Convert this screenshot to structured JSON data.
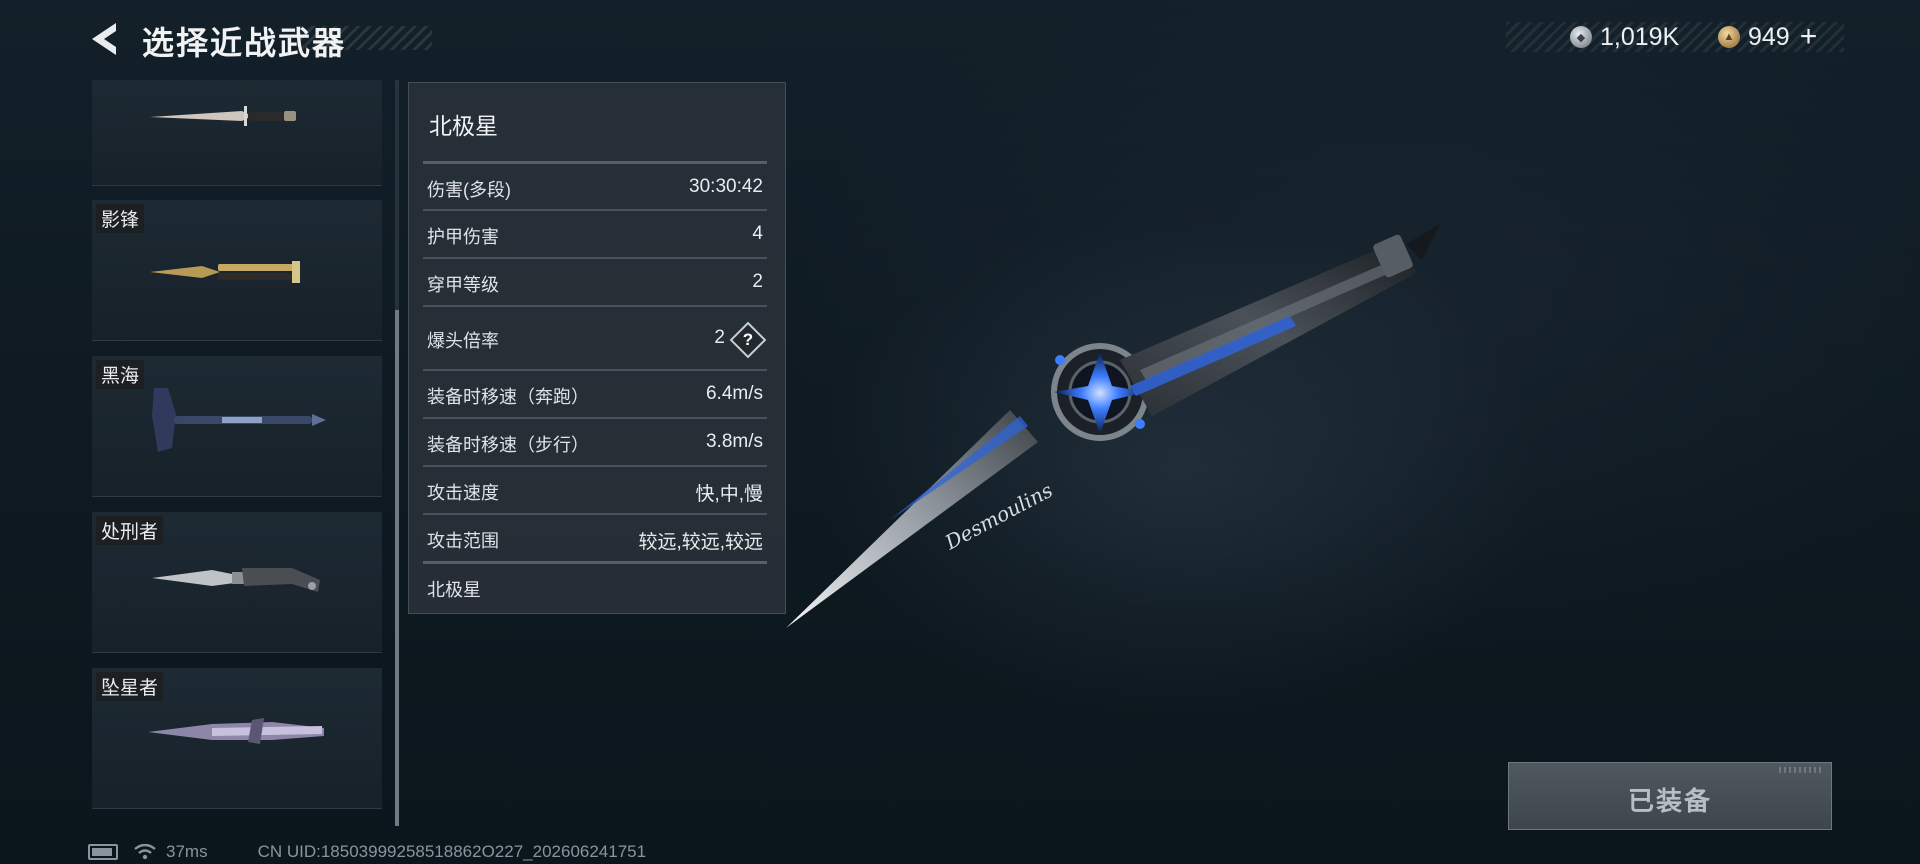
{
  "header": {
    "title": "选择近战武器",
    "currencies": [
      {
        "icon": "silver-coin-icon",
        "value": "1,019K"
      },
      {
        "icon": "gold-coin-icon",
        "value": "949"
      }
    ],
    "add_label": "+"
  },
  "weapon_list": [
    {
      "name": "",
      "icon": "combat-knife-icon"
    },
    {
      "name": "影锋",
      "icon": "butterfly-knife-icon"
    },
    {
      "name": "黑海",
      "icon": "tomahawk-axe-icon"
    },
    {
      "name": "处刑者",
      "icon": "tactical-knife-icon"
    },
    {
      "name": "坠星者",
      "icon": "kunai-blade-icon"
    }
  ],
  "stats": {
    "weapon_name": "北极星",
    "rows": [
      {
        "label": "伤害(多段)",
        "value": "30:30:42"
      },
      {
        "label": "护甲伤害",
        "value": "4"
      },
      {
        "label": "穿甲等级",
        "value": "2"
      },
      {
        "label": "爆头倍率",
        "value": "2",
        "help": "?"
      },
      {
        "label": "装备时移速（奔跑）",
        "value": "6.4m/s"
      },
      {
        "label": "装备时移速（步行）",
        "value": "3.8m/s"
      },
      {
        "label": "攻击速度",
        "value": "快,中,慢"
      },
      {
        "label": "攻击范围",
        "value": "较远,较远,较远"
      }
    ],
    "footer_name": "北极星"
  },
  "display": {
    "blade_engraving": "Desmoulins",
    "accent_color": "#3d7dff"
  },
  "equip_button": {
    "label": "已装备"
  },
  "footer": {
    "ping": "37ms",
    "uid": "CN UID:18503999258518862O227_202606241751"
  }
}
